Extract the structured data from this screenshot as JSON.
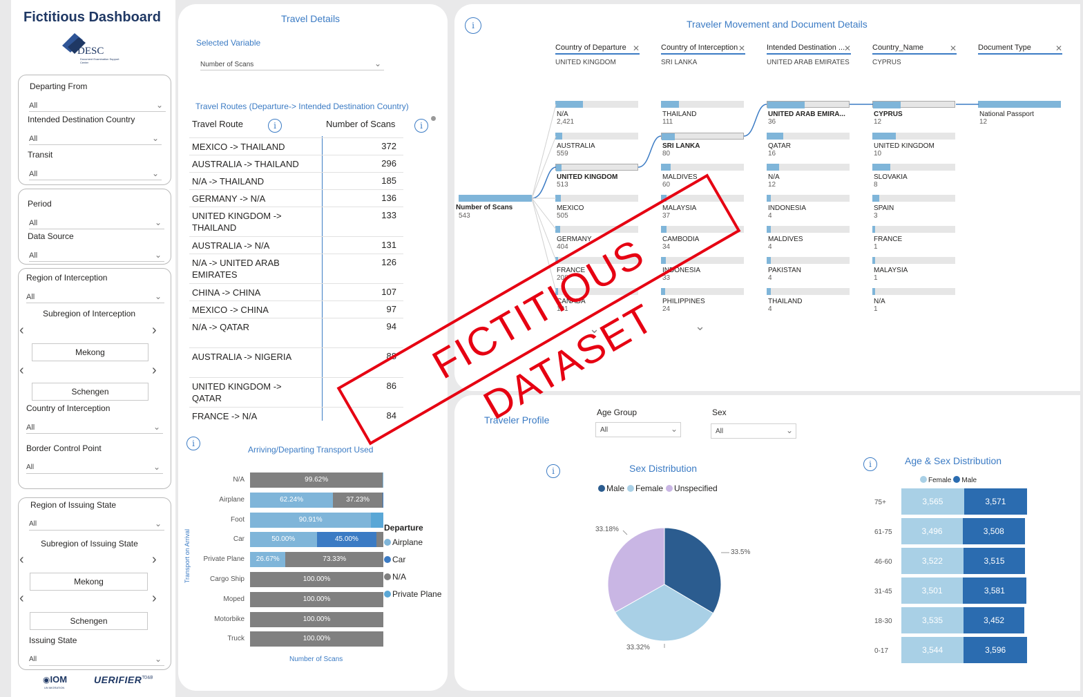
{
  "sidebar": {
    "title": "Fictitious Dashboard",
    "logo_text": "DESC",
    "logo_sub": "Document Examination Support Center",
    "filters1": [
      {
        "label": "Departing From",
        "value": "All"
      },
      {
        "label": "Intended Destination Country",
        "value": "All"
      },
      {
        "label": "Transit",
        "value": "All"
      }
    ],
    "filters2": [
      {
        "label": "Period",
        "value": "All"
      },
      {
        "label": "Data Source",
        "value": "All"
      }
    ],
    "filters3": {
      "region_label": "Region of Interception",
      "region_value": "All",
      "subregion_label": "Subregion of Interception",
      "subregion_items": [
        "Mekong",
        "Schengen"
      ],
      "country_label": "Country of Interception",
      "country_value": "All",
      "bcp_label": "Border Control Point",
      "bcp_value": "All"
    },
    "filters4": {
      "region_label": "Region of Issuing State",
      "region_value": "All",
      "subregion_label": "Subregion of Issuing State",
      "subregion_items": [
        "Mekong",
        "Schengen"
      ],
      "state_label": "Issuing State",
      "state_value": "All"
    },
    "footer_logo1": "IOM",
    "footer_logo1_sub": "UN MIGRATION",
    "footer_logo2": "UERIFIER",
    "footer_logo2_sup": "TD&B"
  },
  "travel": {
    "title": "Travel Details",
    "selected_label": "Selected Variable",
    "selected_value": "Number of Scans",
    "routes_title": "Travel Routes (Departure-> Intended Destination Country)",
    "col_route": "Travel Route",
    "col_scans": "Number of Scans",
    "rows": [
      {
        "route": "MEXICO -> THAILAND",
        "value": "372"
      },
      {
        "route": "AUSTRALIA -> THAILAND",
        "value": "296"
      },
      {
        "route": "N/A -> THAILAND",
        "value": "185"
      },
      {
        "route": "GERMANY -> N/A",
        "value": "136"
      },
      {
        "route": "UNITED KINGDOM -> THAILAND",
        "value": "133"
      },
      {
        "route": "AUSTRALIA -> N/A",
        "value": "131"
      },
      {
        "route": "N/A -> UNITED ARAB EMIRATES",
        "value": "126"
      },
      {
        "route": "CHINA -> CHINA",
        "value": "107"
      },
      {
        "route": "MEXICO -> CHINA",
        "value": "97"
      },
      {
        "route": "N/A -> QATAR",
        "value": "94"
      },
      {
        "route": "AUSTRALIA -> NIGERIA",
        "value": "88"
      },
      {
        "route": "UNITED KINGDOM -> QATAR",
        "value": "86"
      },
      {
        "route": "FRANCE -> N/A",
        "value": "84"
      }
    ]
  },
  "transport": {
    "title": "Arriving/Departing Transport Used",
    "y_axis": "Transport on Arrival",
    "x_axis": "Number of Scans",
    "legend_title": "Departure",
    "legend": [
      {
        "name": "Airplane",
        "color": "#7fb5d9"
      },
      {
        "name": "Car",
        "color": "#3b7bc4"
      },
      {
        "name": "N/A",
        "color": "#808080"
      },
      {
        "name": "Private Plane",
        "color": "#5aa7d6"
      }
    ],
    "rows": [
      {
        "label": "N/A",
        "segs": [
          {
            "pct": 99.62,
            "text": "99.62%",
            "color": "#808080"
          },
          {
            "pct": 0.38,
            "text": "",
            "color": "#7fb5d9"
          }
        ]
      },
      {
        "label": "Airplane",
        "segs": [
          {
            "pct": 62.24,
            "text": "62.24%",
            "color": "#7fb5d9"
          },
          {
            "pct": 37.23,
            "text": "37.23%",
            "color": "#808080"
          },
          {
            "pct": 0.53,
            "text": "",
            "color": "#3b7bc4"
          }
        ]
      },
      {
        "label": "Foot",
        "segs": [
          {
            "pct": 90.91,
            "text": "90.91%",
            "color": "#7fb5d9"
          },
          {
            "pct": 9.09,
            "text": "",
            "color": "#5aa7d6"
          }
        ]
      },
      {
        "label": "Car",
        "segs": [
          {
            "pct": 50.0,
            "text": "50.00%",
            "color": "#7fb5d9"
          },
          {
            "pct": 45.0,
            "text": "45.00%",
            "color": "#3b7bc4"
          },
          {
            "pct": 5.0,
            "text": "",
            "color": "#808080"
          }
        ]
      },
      {
        "label": "Private Plane",
        "segs": [
          {
            "pct": 26.67,
            "text": "26.67%",
            "color": "#7fb5d9"
          },
          {
            "pct": 73.33,
            "text": "73.33%",
            "color": "#808080"
          }
        ]
      },
      {
        "label": "Cargo Ship",
        "segs": [
          {
            "pct": 100,
            "text": "100.00%",
            "color": "#808080"
          }
        ]
      },
      {
        "label": "Moped",
        "segs": [
          {
            "pct": 100,
            "text": "100.00%",
            "color": "#808080"
          }
        ]
      },
      {
        "label": "Motorbike",
        "segs": [
          {
            "pct": 100,
            "text": "100.00%",
            "color": "#808080"
          }
        ]
      },
      {
        "label": "Truck",
        "segs": [
          {
            "pct": 100,
            "text": "100.00%",
            "color": "#808080"
          }
        ]
      }
    ]
  },
  "tree": {
    "title": "Traveler Movement and Document Details",
    "root_label": "Number of Scans",
    "root_value": "543",
    "columns": [
      {
        "header": "Country of Departure",
        "selected": "UNITED KINGDOM",
        "nodes": [
          {
            "name": "N/A",
            "value": "2,421",
            "fill": 0.33,
            "bold": false
          },
          {
            "name": "AUSTRALIA",
            "value": "559",
            "fill": 0.08,
            "bold": false
          },
          {
            "name": "UNITED KINGDOM",
            "value": "513",
            "fill": 0.07,
            "bold": true
          },
          {
            "name": "MEXICO",
            "value": "505",
            "fill": 0.07,
            "bold": false
          },
          {
            "name": "GERMANY",
            "value": "404",
            "fill": 0.06,
            "bold": false
          },
          {
            "name": "FRANCE",
            "value": "208",
            "fill": 0.03,
            "bold": false
          },
          {
            "name": "CANADA",
            "value": "191",
            "fill": 0.03,
            "bold": false
          }
        ]
      },
      {
        "header": "Country of Interception",
        "selected": "SRI LANKA",
        "nodes": [
          {
            "name": "THAILAND",
            "value": "111",
            "fill": 0.22,
            "bold": false
          },
          {
            "name": "SRI LANKA",
            "value": "80",
            "fill": 0.16,
            "bold": true
          },
          {
            "name": "MALDIVES",
            "value": "60",
            "fill": 0.12,
            "bold": false
          },
          {
            "name": "MALAYSIA",
            "value": "37",
            "fill": 0.07,
            "bold": false
          },
          {
            "name": "CAMBODIA",
            "value": "34",
            "fill": 0.07,
            "bold": false
          },
          {
            "name": "INDONESIA",
            "value": "33",
            "fill": 0.06,
            "bold": false
          },
          {
            "name": "PHILIPPINES",
            "value": "24",
            "fill": 0.05,
            "bold": false
          }
        ]
      },
      {
        "header": "Intended Destination ...",
        "selected": "UNITED ARAB EMIRATES",
        "nodes": [
          {
            "name": "UNITED ARAB EMIRA...",
            "value": "36",
            "fill": 0.45,
            "bold": true
          },
          {
            "name": "QATAR",
            "value": "16",
            "fill": 0.2,
            "bold": false
          },
          {
            "name": "N/A",
            "value": "12",
            "fill": 0.15,
            "bold": false
          },
          {
            "name": "INDONESIA",
            "value": "4",
            "fill": 0.05,
            "bold": false
          },
          {
            "name": "MALDIVES",
            "value": "4",
            "fill": 0.05,
            "bold": false
          },
          {
            "name": "PAKISTAN",
            "value": "4",
            "fill": 0.05,
            "bold": false
          },
          {
            "name": "THAILAND",
            "value": "4",
            "fill": 0.05,
            "bold": false
          }
        ]
      },
      {
        "header": "Country_Name",
        "selected": "CYPRUS",
        "nodes": [
          {
            "name": "CYPRUS",
            "value": "12",
            "fill": 0.33,
            "bold": true
          },
          {
            "name": "UNITED KINGDOM",
            "value": "10",
            "fill": 0.28,
            "bold": false
          },
          {
            "name": "SLOVAKIA",
            "value": "8",
            "fill": 0.22,
            "bold": false
          },
          {
            "name": "SPAIN",
            "value": "3",
            "fill": 0.08,
            "bold": false
          },
          {
            "name": "FRANCE",
            "value": "1",
            "fill": 0.03,
            "bold": false
          },
          {
            "name": "MALAYSIA",
            "value": "1",
            "fill": 0.03,
            "bold": false
          },
          {
            "name": "N/A",
            "value": "1",
            "fill": 0.03,
            "bold": false
          }
        ]
      },
      {
        "header": "Document Type",
        "selected": "",
        "nodes": [
          {
            "name": "National Passport",
            "value": "12",
            "fill": 1.0,
            "bold": false
          }
        ]
      }
    ]
  },
  "profile": {
    "title": "Traveler Profile",
    "age_label": "Age Group",
    "age_value": "All",
    "sex_label": "Sex",
    "sex_value": "All",
    "sex_title": "Sex Distribution",
    "sex_legend": [
      {
        "name": "Male",
        "color": "#2b5c8f"
      },
      {
        "name": "Female",
        "color": "#a9d0e6"
      },
      {
        "name": "Unspecified",
        "color": "#c9b6e4"
      }
    ],
    "pie_labels": [
      "33.5%",
      "33.32%",
      "33.18%"
    ],
    "agesex_title": "Age & Sex Distribution",
    "agesex_legend": [
      {
        "name": "Female",
        "color": "#a9d0e6"
      },
      {
        "name": "Male",
        "color": "#2b6cb0"
      }
    ],
    "agesex_rows": [
      {
        "group": "75+",
        "female": "3,565",
        "male": "3,571"
      },
      {
        "group": "61-75",
        "female": "3,496",
        "male": "3,508"
      },
      {
        "group": "46-60",
        "female": "3,522",
        "male": "3,515"
      },
      {
        "group": "31-45",
        "female": "3,501",
        "male": "3,581"
      },
      {
        "group": "18-30",
        "female": "3,535",
        "male": "3,452"
      },
      {
        "group": "0-17",
        "female": "3,544",
        "male": "3,596"
      }
    ]
  },
  "chart_data": [
    {
      "type": "bar",
      "title": "Arriving/Departing Transport Used",
      "xlabel": "Number of Scans",
      "ylabel": "Transport on Arrival",
      "categories": [
        "N/A",
        "Airplane",
        "Foot",
        "Car",
        "Private Plane",
        "Cargo Ship",
        "Moped",
        "Motorbike",
        "Truck"
      ],
      "series": [
        {
          "name": "Airplane",
          "values": [
            0,
            62.24,
            90.91,
            50.0,
            26.67,
            0,
            0,
            0,
            0
          ]
        },
        {
          "name": "Car",
          "values": [
            0,
            0,
            0,
            45.0,
            0,
            0,
            0,
            0,
            0
          ]
        },
        {
          "name": "N/A",
          "values": [
            99.62,
            37.23,
            0,
            0,
            73.33,
            100,
            100,
            100,
            100
          ]
        }
      ]
    },
    {
      "type": "pie",
      "title": "Sex Distribution",
      "categories": [
        "Male",
        "Female",
        "Unspecified"
      ],
      "values": [
        33.5,
        33.32,
        33.18
      ]
    },
    {
      "type": "bar",
      "title": "Age & Sex Distribution",
      "categories": [
        "75+",
        "61-75",
        "46-60",
        "31-45",
        "18-30",
        "0-17"
      ],
      "series": [
        {
          "name": "Female",
          "values": [
            3565,
            3496,
            3522,
            3501,
            3535,
            3544
          ]
        },
        {
          "name": "Male",
          "values": [
            3571,
            3508,
            3515,
            3581,
            3452,
            3596
          ]
        }
      ]
    }
  ],
  "stamp": "FICTITIOUS DATASET"
}
